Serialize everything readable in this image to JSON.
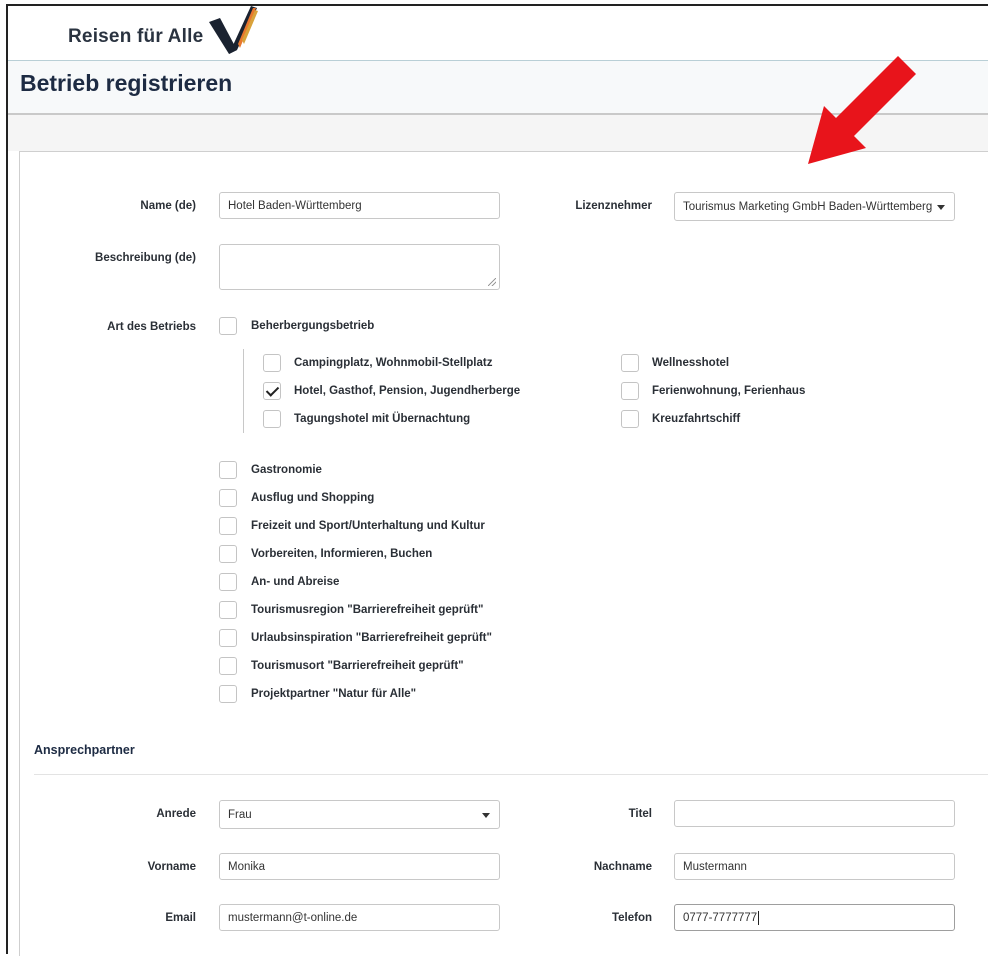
{
  "brand": {
    "name": "Reisen für Alle",
    "colors": {
      "mark_dark": "#1a2230",
      "mark_orange": "#e8772e",
      "mark_gold": "#d9a23a"
    }
  },
  "page": {
    "title": "Betrieb registrieren"
  },
  "form": {
    "name": {
      "label": "Name (de)",
      "value": "Hotel Baden-Württemberg"
    },
    "lizenznehmer": {
      "label": "Lizenznehmer",
      "value": "Tourismus Marketing GmbH Baden-Württemberg"
    },
    "beschreibung": {
      "label": "Beschreibung (de)",
      "value": ""
    },
    "art": {
      "label": "Art des Betriebs",
      "parent": {
        "label": "Beherbergungsbetrieb",
        "checked": false
      },
      "sub_left": [
        {
          "label": "Campingplatz, Wohnmobil-Stellplatz",
          "checked": false
        },
        {
          "label": "Hotel, Gasthof, Pension, Jugendherberge",
          "checked": true
        },
        {
          "label": "Tagungshotel mit Übernachtung",
          "checked": false
        }
      ],
      "sub_right": [
        {
          "label": "Wellnesshotel",
          "checked": false
        },
        {
          "label": "Ferienwohnung, Ferienhaus",
          "checked": false
        },
        {
          "label": "Kreuzfahrtschiff",
          "checked": false
        }
      ],
      "others": [
        {
          "label": "Gastronomie",
          "checked": false
        },
        {
          "label": "Ausflug und Shopping",
          "checked": false
        },
        {
          "label": "Freizeit und Sport/Unterhaltung und Kultur",
          "checked": false
        },
        {
          "label": "Vorbereiten, Informieren, Buchen",
          "checked": false
        },
        {
          "label": "An- und Abreise",
          "checked": false
        },
        {
          "label": "Tourismusregion \"Barrierefreiheit geprüft\"",
          "checked": false
        },
        {
          "label": "Urlaubsinspiration \"Barrierefreiheit geprüft\"",
          "checked": false
        },
        {
          "label": "Tourismusort \"Barrierefreiheit geprüft\"",
          "checked": false
        },
        {
          "label": "Projektpartner \"Natur für Alle\"",
          "checked": false
        }
      ]
    }
  },
  "contact": {
    "title": "Ansprechpartner",
    "anrede": {
      "label": "Anrede",
      "value": "Frau"
    },
    "titel": {
      "label": "Titel",
      "value": ""
    },
    "vorname": {
      "label": "Vorname",
      "value": "Monika"
    },
    "nachname": {
      "label": "Nachname",
      "value": "Mustermann"
    },
    "email": {
      "label": "Email",
      "value": "mustermann@t-online.de"
    },
    "telefon": {
      "label": "Telefon",
      "value": "0777-7777777"
    }
  },
  "annotation": {
    "icon": "red-arrow-icon",
    "color": "#e8141b"
  }
}
